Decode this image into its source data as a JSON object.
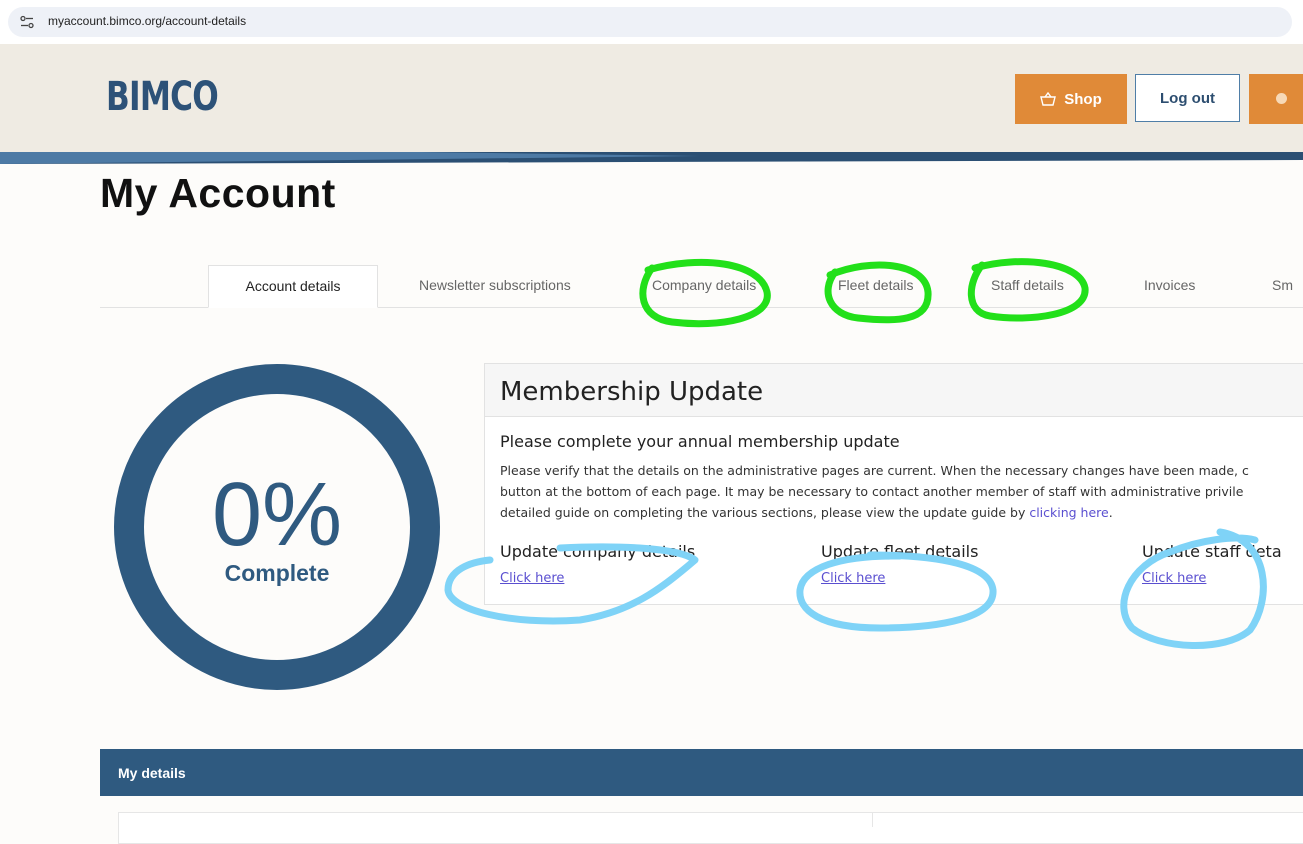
{
  "browser": {
    "url": "myaccount.bimco.org/account-details"
  },
  "header": {
    "logo": "BIMCO",
    "shop_label": "Shop",
    "logout_label": "Log out"
  },
  "page": {
    "title": "My Account"
  },
  "tabs": [
    {
      "label": "Account details",
      "active": true
    },
    {
      "label": "Newsletter subscriptions",
      "active": false
    },
    {
      "label": "Company details",
      "active": false
    },
    {
      "label": "Fleet details",
      "active": false
    },
    {
      "label": "Staff details",
      "active": false
    },
    {
      "label": "Invoices",
      "active": false
    },
    {
      "label": "Sm",
      "active": false
    }
  ],
  "progress": {
    "percent_text": "0%",
    "label": "Complete",
    "value": 0
  },
  "membership": {
    "title": "Membership Update",
    "subtitle": "Please complete your annual membership update",
    "body_line1": "Please verify that the details on the administrative pages are current. When the necessary changes have been made, c",
    "body_line2": "button at the bottom of each page. It may be necessary to contact another member of staff with administrative privile",
    "body_line3_prefix": "detailed guide on completing the various sections, please view the update guide by ",
    "body_line3_link": "clicking here",
    "body_line3_suffix": ".",
    "sections": [
      {
        "heading": "Update company details",
        "link": "Click here"
      },
      {
        "heading": "Update fleet details",
        "link": "Click here"
      },
      {
        "heading": "Update staff deta",
        "link": "Click here"
      }
    ]
  },
  "details": {
    "title": "My details"
  },
  "colors": {
    "brand_blue": "#2f5a80",
    "brand_orange": "#e08a38",
    "annotation_green": "#22e01a",
    "annotation_blue": "#7fd3f7",
    "link": "#5a4fd0"
  }
}
